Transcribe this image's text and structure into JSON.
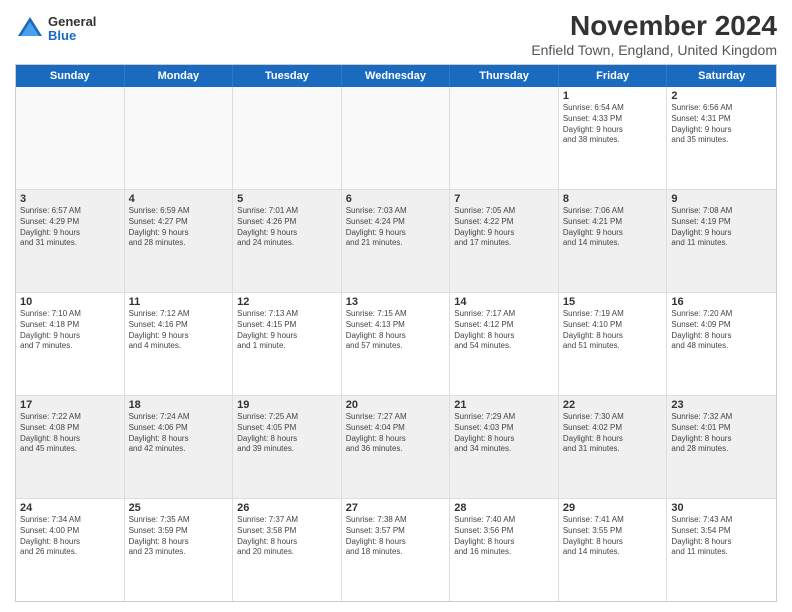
{
  "logo": {
    "general": "General",
    "blue": "Blue"
  },
  "title": "November 2024",
  "subtitle": "Enfield Town, England, United Kingdom",
  "header_days": [
    "Sunday",
    "Monday",
    "Tuesday",
    "Wednesday",
    "Thursday",
    "Friday",
    "Saturday"
  ],
  "weeks": [
    [
      {
        "day": "",
        "empty": true
      },
      {
        "day": "",
        "empty": true
      },
      {
        "day": "",
        "empty": true
      },
      {
        "day": "",
        "empty": true
      },
      {
        "day": "",
        "empty": true
      },
      {
        "day": "1",
        "info": "Sunrise: 6:54 AM\nSunset: 4:33 PM\nDaylight: 9 hours\nand 38 minutes."
      },
      {
        "day": "2",
        "info": "Sunrise: 6:56 AM\nSunset: 4:31 PM\nDaylight: 9 hours\nand 35 minutes."
      }
    ],
    [
      {
        "day": "3",
        "info": "Sunrise: 6:57 AM\nSunset: 4:29 PM\nDaylight: 9 hours\nand 31 minutes.",
        "shaded": true
      },
      {
        "day": "4",
        "info": "Sunrise: 6:59 AM\nSunset: 4:27 PM\nDaylight: 9 hours\nand 28 minutes.",
        "shaded": true
      },
      {
        "day": "5",
        "info": "Sunrise: 7:01 AM\nSunset: 4:26 PM\nDaylight: 9 hours\nand 24 minutes.",
        "shaded": true
      },
      {
        "day": "6",
        "info": "Sunrise: 7:03 AM\nSunset: 4:24 PM\nDaylight: 9 hours\nand 21 minutes.",
        "shaded": true
      },
      {
        "day": "7",
        "info": "Sunrise: 7:05 AM\nSunset: 4:22 PM\nDaylight: 9 hours\nand 17 minutes.",
        "shaded": true
      },
      {
        "day": "8",
        "info": "Sunrise: 7:06 AM\nSunset: 4:21 PM\nDaylight: 9 hours\nand 14 minutes.",
        "shaded": true
      },
      {
        "day": "9",
        "info": "Sunrise: 7:08 AM\nSunset: 4:19 PM\nDaylight: 9 hours\nand 11 minutes.",
        "shaded": true
      }
    ],
    [
      {
        "day": "10",
        "info": "Sunrise: 7:10 AM\nSunset: 4:18 PM\nDaylight: 9 hours\nand 7 minutes."
      },
      {
        "day": "11",
        "info": "Sunrise: 7:12 AM\nSunset: 4:16 PM\nDaylight: 9 hours\nand 4 minutes."
      },
      {
        "day": "12",
        "info": "Sunrise: 7:13 AM\nSunset: 4:15 PM\nDaylight: 9 hours\nand 1 minute."
      },
      {
        "day": "13",
        "info": "Sunrise: 7:15 AM\nSunset: 4:13 PM\nDaylight: 8 hours\nand 57 minutes."
      },
      {
        "day": "14",
        "info": "Sunrise: 7:17 AM\nSunset: 4:12 PM\nDaylight: 8 hours\nand 54 minutes."
      },
      {
        "day": "15",
        "info": "Sunrise: 7:19 AM\nSunset: 4:10 PM\nDaylight: 8 hours\nand 51 minutes."
      },
      {
        "day": "16",
        "info": "Sunrise: 7:20 AM\nSunset: 4:09 PM\nDaylight: 8 hours\nand 48 minutes."
      }
    ],
    [
      {
        "day": "17",
        "info": "Sunrise: 7:22 AM\nSunset: 4:08 PM\nDaylight: 8 hours\nand 45 minutes.",
        "shaded": true
      },
      {
        "day": "18",
        "info": "Sunrise: 7:24 AM\nSunset: 4:06 PM\nDaylight: 8 hours\nand 42 minutes.",
        "shaded": true
      },
      {
        "day": "19",
        "info": "Sunrise: 7:25 AM\nSunset: 4:05 PM\nDaylight: 8 hours\nand 39 minutes.",
        "shaded": true
      },
      {
        "day": "20",
        "info": "Sunrise: 7:27 AM\nSunset: 4:04 PM\nDaylight: 8 hours\nand 36 minutes.",
        "shaded": true
      },
      {
        "day": "21",
        "info": "Sunrise: 7:29 AM\nSunset: 4:03 PM\nDaylight: 8 hours\nand 34 minutes.",
        "shaded": true
      },
      {
        "day": "22",
        "info": "Sunrise: 7:30 AM\nSunset: 4:02 PM\nDaylight: 8 hours\nand 31 minutes.",
        "shaded": true
      },
      {
        "day": "23",
        "info": "Sunrise: 7:32 AM\nSunset: 4:01 PM\nDaylight: 8 hours\nand 28 minutes.",
        "shaded": true
      }
    ],
    [
      {
        "day": "24",
        "info": "Sunrise: 7:34 AM\nSunset: 4:00 PM\nDaylight: 8 hours\nand 26 minutes."
      },
      {
        "day": "25",
        "info": "Sunrise: 7:35 AM\nSunset: 3:59 PM\nDaylight: 8 hours\nand 23 minutes."
      },
      {
        "day": "26",
        "info": "Sunrise: 7:37 AM\nSunset: 3:58 PM\nDaylight: 8 hours\nand 20 minutes."
      },
      {
        "day": "27",
        "info": "Sunrise: 7:38 AM\nSunset: 3:57 PM\nDaylight: 8 hours\nand 18 minutes."
      },
      {
        "day": "28",
        "info": "Sunrise: 7:40 AM\nSunset: 3:56 PM\nDaylight: 8 hours\nand 16 minutes."
      },
      {
        "day": "29",
        "info": "Sunrise: 7:41 AM\nSunset: 3:55 PM\nDaylight: 8 hours\nand 14 minutes."
      },
      {
        "day": "30",
        "info": "Sunrise: 7:43 AM\nSunset: 3:54 PM\nDaylight: 8 hours\nand 11 minutes."
      }
    ]
  ]
}
